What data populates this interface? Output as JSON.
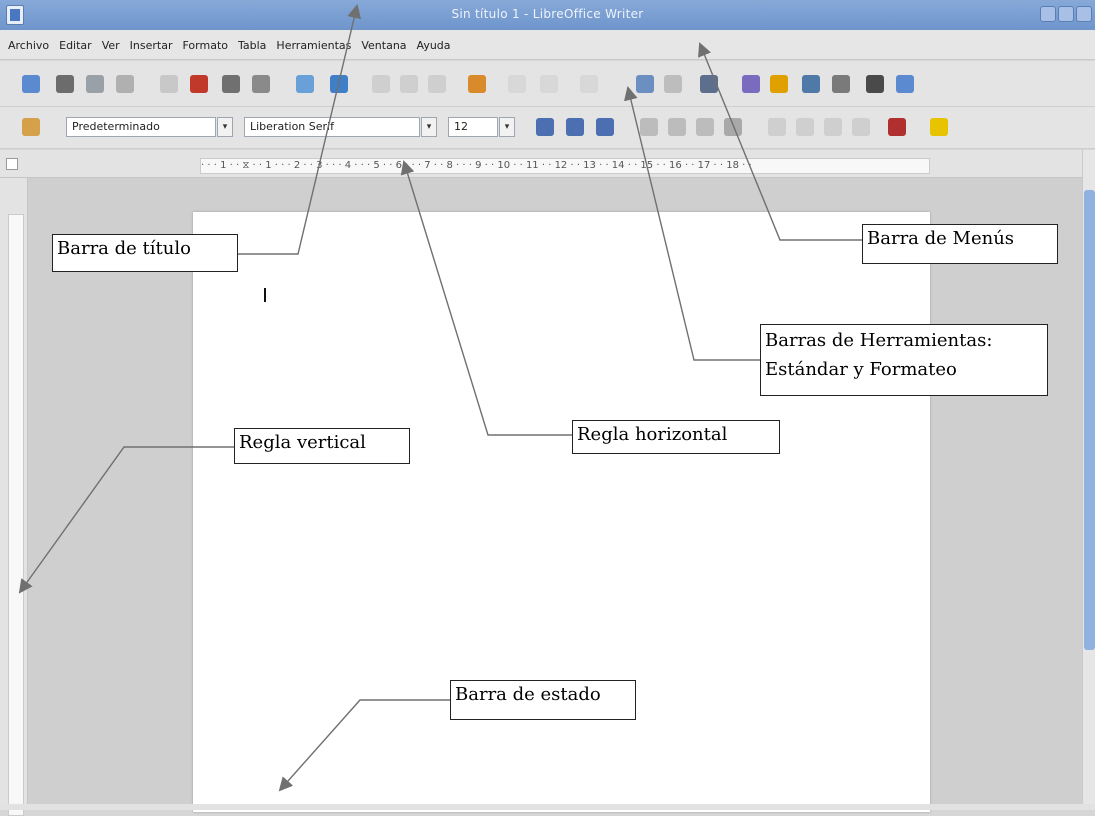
{
  "titlebar": {
    "title": "Sin título 1 - LibreOffice Writer",
    "app_icon": "document-icon",
    "buttons": [
      "minimize-icon",
      "maximize-icon",
      "close-icon"
    ]
  },
  "menubar": {
    "items": [
      "Archivo",
      "Editar",
      "Ver",
      "Insertar",
      "Formato",
      "Tabla",
      "Herramientas",
      "Ventana",
      "Ayuda"
    ]
  },
  "toolbar_format": {
    "style_value": "Predeterminado",
    "font_value": "Liberation Serif",
    "size_value": "12"
  },
  "ruler_h": {
    "ticks": "· · · 1 · · ⧖ · · 1 · · · 2 · · 3 · · · 4 · · · 5 · · 6 · · · 7 · · 8 · · · 9 · · 10 · · 11 · · 12 · · 13 · · 14 · · 15 · · 16 · · 17 · · 18 · ·"
  },
  "callouts": {
    "barra_titulo": "Barra de título",
    "barra_menus": "Barra de Menús",
    "barras_herramientas_1": "Barras de Herramientas:",
    "barras_herramientas_2": "Estándar y Formateo",
    "regla_horizontal": "Regla horizontal",
    "regla_vertical": "Regla vertical",
    "barra_estado": "Barra de estado"
  },
  "colors": {
    "titlebar": "#7c9fd3",
    "accent": "#8fb2e0"
  }
}
